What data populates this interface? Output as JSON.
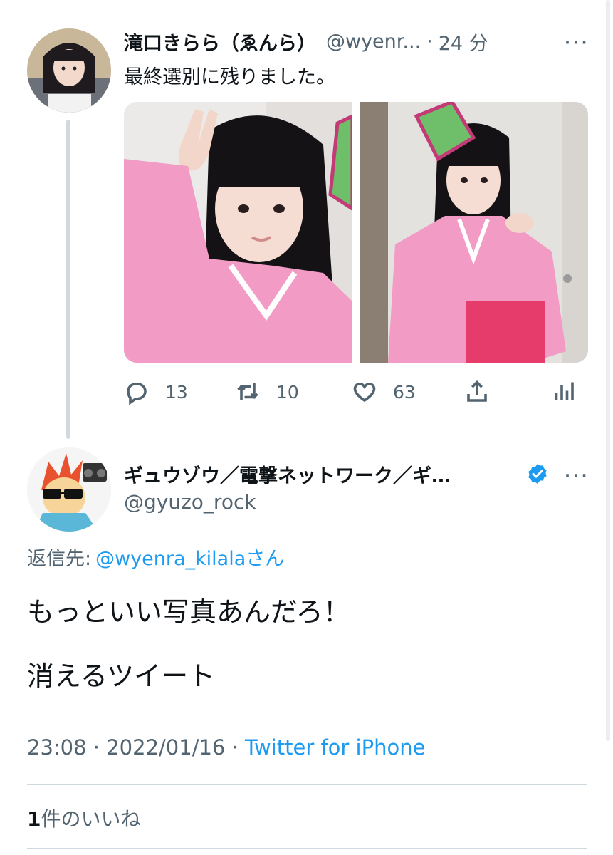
{
  "parent_tweet": {
    "display_name": "滝口きらら（ゑんら）",
    "handle": "@wyenr...",
    "separator": "·",
    "time": "24 分",
    "text": "最終選別に残りました。",
    "actions": {
      "reply_count": "13",
      "retweet_count": "10",
      "like_count": "63"
    },
    "icons": [
      "reply-icon",
      "retweet-icon",
      "heart-icon",
      "share-icon",
      "stats-icon",
      "more-icon"
    ]
  },
  "reply_tweet": {
    "display_name": "ギュウゾウ／電撃ネットワーク／ギ…",
    "handle": "@gyuzo_rock",
    "verified": true,
    "reply_to_label": "返信先:",
    "reply_to_mention": "@wyenra_kilala",
    "reply_to_suffix": "さん",
    "text_line1": "もっといい写真あんだろ！",
    "text_line2": "消えるツイート",
    "timestamp_time": "23:08",
    "timestamp_sep1": " · ",
    "timestamp_date": "2022/01/16",
    "timestamp_sep2": " · ",
    "source": "Twitter for iPhone",
    "likes_count": "1",
    "likes_label": "件のいいね"
  },
  "colors": {
    "accent": "#1d9bf0",
    "secondary_text": "#536471",
    "primary_text": "#0f1419",
    "thread_line": "#cfd9de"
  }
}
